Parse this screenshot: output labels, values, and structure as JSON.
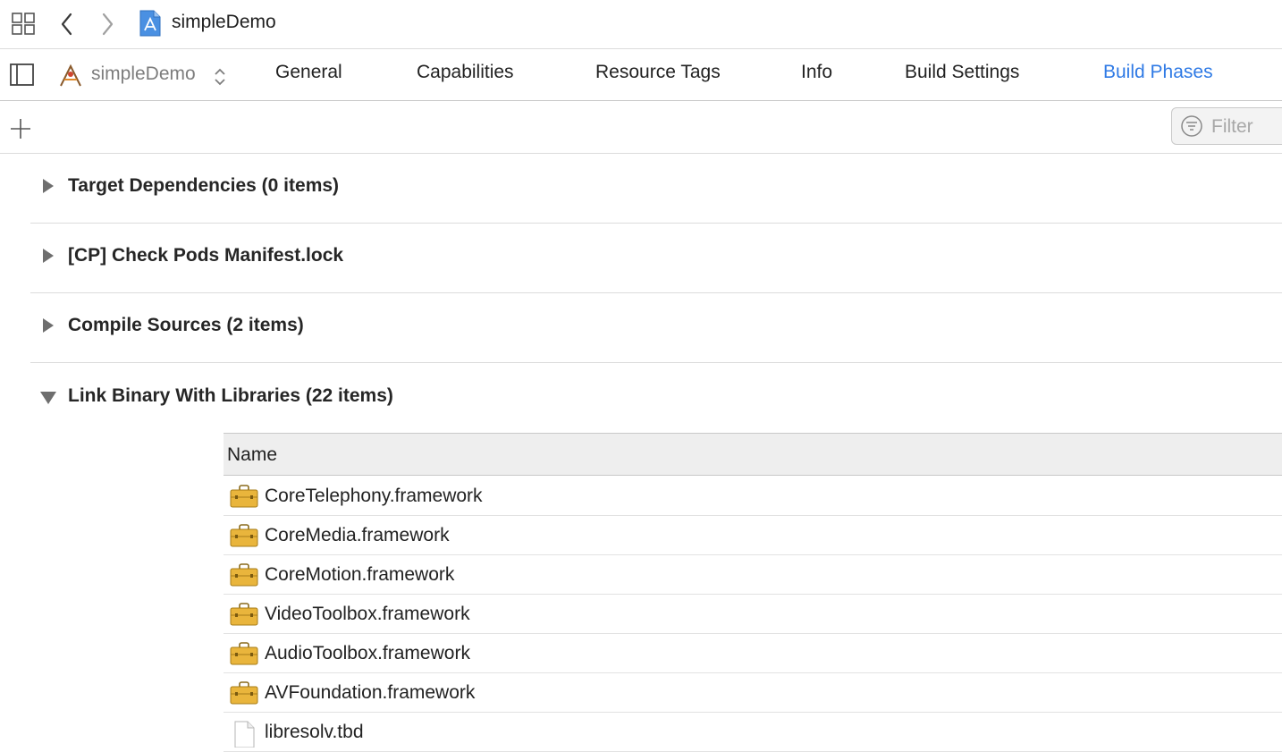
{
  "window": {
    "title": "simpleDemo"
  },
  "tabbar": {
    "target": "simpleDemo",
    "tabs": [
      {
        "label": "General"
      },
      {
        "label": "Capabilities"
      },
      {
        "label": "Resource Tags"
      },
      {
        "label": "Info"
      },
      {
        "label": "Build Settings"
      },
      {
        "label": "Build Phases"
      }
    ],
    "active_tab": "Build Phases"
  },
  "toolbar": {
    "filter_placeholder": "Filter"
  },
  "phases": [
    {
      "title": "Target Dependencies (0 items)",
      "expanded": false
    },
    {
      "title": "[CP] Check Pods Manifest.lock",
      "expanded": false
    },
    {
      "title": "Compile Sources (2 items)",
      "expanded": false
    },
    {
      "title": "Link Binary With Libraries (22 items)",
      "expanded": true
    }
  ],
  "libraries": {
    "column_header": "Name",
    "items": [
      {
        "name": "CoreTelephony.framework",
        "icon": "framework-icon"
      },
      {
        "name": "CoreMedia.framework",
        "icon": "framework-icon"
      },
      {
        "name": "CoreMotion.framework",
        "icon": "framework-icon"
      },
      {
        "name": "VideoToolbox.framework",
        "icon": "framework-icon"
      },
      {
        "name": "AudioToolbox.framework",
        "icon": "framework-icon"
      },
      {
        "name": "AVFoundation.framework",
        "icon": "framework-icon"
      },
      {
        "name": "libresolv.tbd",
        "icon": "document-icon"
      }
    ]
  },
  "colors": {
    "accent": "#2f7ae5",
    "framework_icon": "#e9b53c"
  }
}
